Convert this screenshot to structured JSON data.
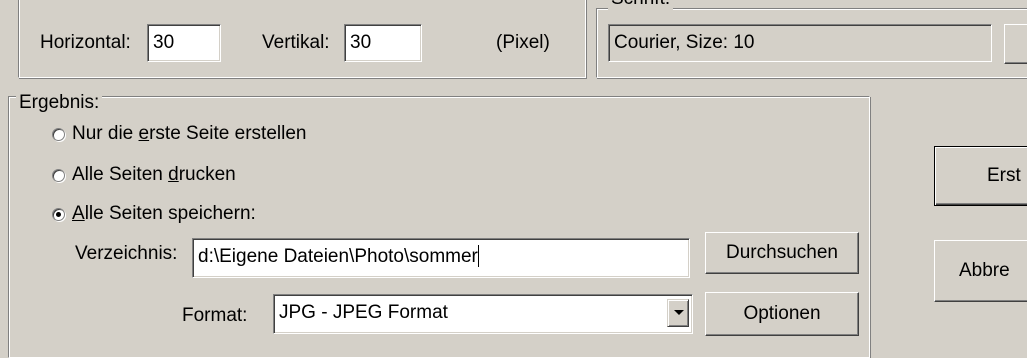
{
  "spacing": {
    "horizontal_label": "Horizontal:",
    "horizontal_value": "30",
    "vertical_label": "Vertikal:",
    "vertical_value": "30",
    "unit": "(Pixel)"
  },
  "font_group": {
    "legend": "Schrift:",
    "font_value": "Courier, Size: 10"
  },
  "result": {
    "legend": "Ergebnis:",
    "options": [
      {
        "pre": "Nur die ",
        "accel": "e",
        "post": "rste Seite erstellen",
        "checked": false
      },
      {
        "pre": "Alle Seiten ",
        "accel": "d",
        "post": "rucken",
        "checked": false
      },
      {
        "pre": "",
        "accel": "A",
        "post": "lle Seiten speichern:",
        "checked": true
      }
    ],
    "directory_label": "Verzeichnis:",
    "directory_value": "d:\\Eigene Dateien\\Photo\\sommer",
    "browse_button": "Durchsuchen",
    "format_label": "Format:",
    "format_value": "JPG - JPEG Format",
    "options_button": "Optionen"
  },
  "actions": {
    "create_button": "Erst",
    "cancel_button": "Abbre"
  }
}
